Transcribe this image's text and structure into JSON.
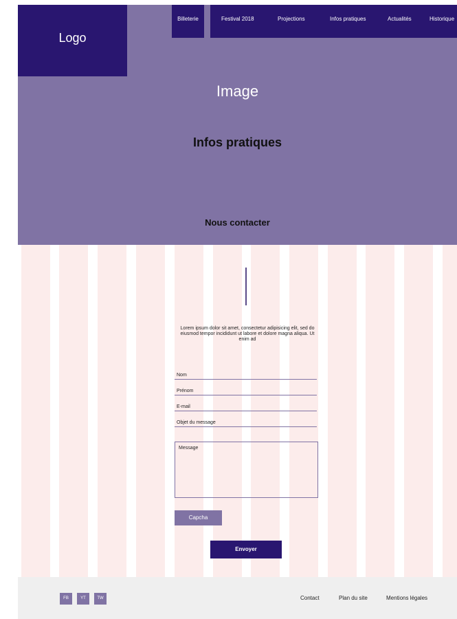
{
  "header": {
    "logo": "Logo",
    "nav": {
      "billetterie": "Billeterie",
      "items": [
        "Festival 2018",
        "Projections",
        "Infos pratiques",
        "Actualités",
        "Historique"
      ]
    }
  },
  "hero": {
    "image_placeholder": "Image",
    "title": "Infos pratiques",
    "subtitle": "Nous contacter"
  },
  "contact": {
    "intro": "Lorem ipsum dolor sit amet, consectetur adipisicing elit, sed do eiusmod tempor incididunt ut labore et dolore magna aliqua. Ut enim ad",
    "fields": [
      "Nom",
      "Prénom",
      "E-mail",
      "Objet du message"
    ],
    "message_label": "Message",
    "captcha_label": "Capcha",
    "submit_label": "Envoyer"
  },
  "footer": {
    "social": [
      "FB",
      "YT",
      "TW"
    ],
    "links": [
      "Contact",
      "Plan du site",
      "Mentions légales"
    ]
  },
  "colors": {
    "primary": "#291670",
    "secondary": "#8073a4",
    "grid_stripe": "#fceceb",
    "footer_bg": "#efefef"
  }
}
